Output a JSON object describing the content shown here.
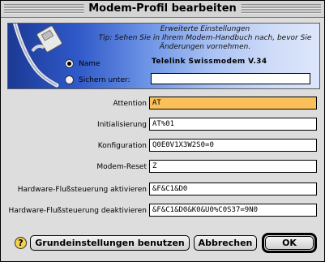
{
  "window": {
    "title": "Modem-Profil bearbeiten"
  },
  "banner": {
    "hint_title": "Erweiterte Einstellungen",
    "hint_line1": "Tip: Sehen Sie in Ihrem Modem-Handbuch nach, bevor Sie",
    "hint_line2": "Änderungen vornehmen.",
    "name_option": {
      "label": "Name",
      "selected": true
    },
    "save_option": {
      "label": "Sichern unter:",
      "selected": false,
      "value": ""
    },
    "modem_name": "Telelink Swissmodem V.34"
  },
  "fields": [
    {
      "label": "Attention",
      "value": "AT",
      "active": true
    },
    {
      "label": "Initialisierung",
      "value": "AT%01"
    },
    {
      "label": "Konfiguration",
      "value": "Q0E0V1X3W2S0=0"
    },
    {
      "label": "Modem-Reset",
      "value": "Z"
    },
    {
      "label": "Hardware-Flußsteuerung aktivieren",
      "value": "&F&C1&D0"
    },
    {
      "label": "Hardware-Flußsteuerung deaktivieren",
      "value": "&F&C1&D0&K0&U0%C0S37=9N0"
    }
  ],
  "buttons": {
    "help": "?",
    "defaults": "Grundeinstellungen benutzen",
    "cancel": "Abbrechen",
    "ok": "OK"
  },
  "colors": {
    "active_field": "#fbc05a",
    "banner_dark": "#1c3a95",
    "banner_light": "#dde6fb"
  }
}
